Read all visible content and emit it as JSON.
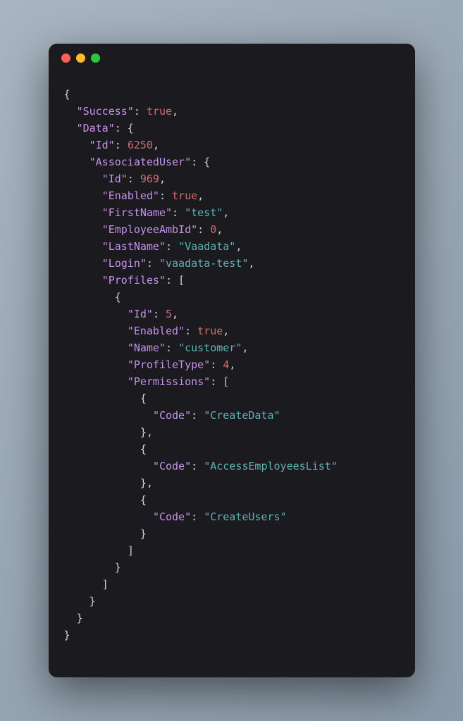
{
  "window": {
    "traffic_lights": {
      "red": "#ff5f56",
      "yellow": "#ffbd2e",
      "green": "#27c93f"
    }
  },
  "code": {
    "lines": [
      {
        "indent": 0,
        "tokens": [
          {
            "t": "punct",
            "v": "{"
          }
        ]
      },
      {
        "indent": 1,
        "tokens": [
          {
            "t": "key",
            "v": "\"Success\""
          },
          {
            "t": "punct",
            "v": ": "
          },
          {
            "t": "bool",
            "v": "true"
          },
          {
            "t": "punct",
            "v": ","
          }
        ]
      },
      {
        "indent": 1,
        "tokens": [
          {
            "t": "key",
            "v": "\"Data\""
          },
          {
            "t": "punct",
            "v": ": {"
          }
        ]
      },
      {
        "indent": 2,
        "tokens": [
          {
            "t": "key",
            "v": "\"Id\""
          },
          {
            "t": "punct",
            "v": ": "
          },
          {
            "t": "number",
            "v": "6250"
          },
          {
            "t": "punct",
            "v": ","
          }
        ]
      },
      {
        "indent": 2,
        "tokens": [
          {
            "t": "key",
            "v": "\"AssociatedUser\""
          },
          {
            "t": "punct",
            "v": ": {"
          }
        ]
      },
      {
        "indent": 3,
        "tokens": [
          {
            "t": "key",
            "v": "\"Id\""
          },
          {
            "t": "punct",
            "v": ": "
          },
          {
            "t": "number",
            "v": "969"
          },
          {
            "t": "punct",
            "v": ","
          }
        ]
      },
      {
        "indent": 3,
        "tokens": [
          {
            "t": "key",
            "v": "\"Enabled\""
          },
          {
            "t": "punct",
            "v": ": "
          },
          {
            "t": "bool",
            "v": "true"
          },
          {
            "t": "punct",
            "v": ","
          }
        ]
      },
      {
        "indent": 3,
        "tokens": [
          {
            "t": "key",
            "v": "\"FirstName\""
          },
          {
            "t": "punct",
            "v": ": "
          },
          {
            "t": "string",
            "v": "\"test\""
          },
          {
            "t": "punct",
            "v": ","
          }
        ]
      },
      {
        "indent": 3,
        "tokens": [
          {
            "t": "key",
            "v": "\"EmployeeAmbId\""
          },
          {
            "t": "punct",
            "v": ": "
          },
          {
            "t": "number",
            "v": "0"
          },
          {
            "t": "punct",
            "v": ","
          }
        ]
      },
      {
        "indent": 3,
        "tokens": [
          {
            "t": "key",
            "v": "\"LastName\""
          },
          {
            "t": "punct",
            "v": ": "
          },
          {
            "t": "string",
            "v": "\"Vaadata\""
          },
          {
            "t": "punct",
            "v": ","
          }
        ]
      },
      {
        "indent": 3,
        "tokens": [
          {
            "t": "key",
            "v": "\"Login\""
          },
          {
            "t": "punct",
            "v": ": "
          },
          {
            "t": "string",
            "v": "\"vaadata-test\""
          },
          {
            "t": "punct",
            "v": ","
          }
        ]
      },
      {
        "indent": 3,
        "tokens": [
          {
            "t": "key",
            "v": "\"Profiles\""
          },
          {
            "t": "punct",
            "v": ": ["
          }
        ]
      },
      {
        "indent": 4,
        "tokens": [
          {
            "t": "punct",
            "v": "{"
          }
        ]
      },
      {
        "indent": 5,
        "tokens": [
          {
            "t": "key",
            "v": "\"Id\""
          },
          {
            "t": "punct",
            "v": ": "
          },
          {
            "t": "number",
            "v": "5"
          },
          {
            "t": "punct",
            "v": ","
          }
        ]
      },
      {
        "indent": 5,
        "tokens": [
          {
            "t": "key",
            "v": "\"Enabled\""
          },
          {
            "t": "punct",
            "v": ": "
          },
          {
            "t": "bool",
            "v": "true"
          },
          {
            "t": "punct",
            "v": ","
          }
        ]
      },
      {
        "indent": 5,
        "tokens": [
          {
            "t": "key",
            "v": "\"Name\""
          },
          {
            "t": "punct",
            "v": ": "
          },
          {
            "t": "string",
            "v": "\"customer\""
          },
          {
            "t": "punct",
            "v": ","
          }
        ]
      },
      {
        "indent": 5,
        "tokens": [
          {
            "t": "key",
            "v": "\"ProfileType\""
          },
          {
            "t": "punct",
            "v": ": "
          },
          {
            "t": "number",
            "v": "4"
          },
          {
            "t": "punct",
            "v": ","
          }
        ]
      },
      {
        "indent": 5,
        "tokens": [
          {
            "t": "key",
            "v": "\"Permissions\""
          },
          {
            "t": "punct",
            "v": ": ["
          }
        ]
      },
      {
        "indent": 6,
        "tokens": [
          {
            "t": "punct",
            "v": "{"
          }
        ]
      },
      {
        "indent": 7,
        "tokens": [
          {
            "t": "key",
            "v": "\"Code\""
          },
          {
            "t": "punct",
            "v": ": "
          },
          {
            "t": "string",
            "v": "\"CreateData\""
          }
        ]
      },
      {
        "indent": 6,
        "tokens": [
          {
            "t": "punct",
            "v": "},"
          }
        ]
      },
      {
        "indent": 6,
        "tokens": [
          {
            "t": "punct",
            "v": "{"
          }
        ]
      },
      {
        "indent": 7,
        "tokens": [
          {
            "t": "key",
            "v": "\"Code\""
          },
          {
            "t": "punct",
            "v": ": "
          },
          {
            "t": "string",
            "v": "\"AccessEmployeesList\""
          }
        ]
      },
      {
        "indent": 6,
        "tokens": [
          {
            "t": "punct",
            "v": "},"
          }
        ]
      },
      {
        "indent": 6,
        "tokens": [
          {
            "t": "punct",
            "v": "{"
          }
        ]
      },
      {
        "indent": 7,
        "tokens": [
          {
            "t": "key",
            "v": "\"Code\""
          },
          {
            "t": "punct",
            "v": ": "
          },
          {
            "t": "string",
            "v": "\"CreateUsers\""
          }
        ]
      },
      {
        "indent": 6,
        "tokens": [
          {
            "t": "punct",
            "v": "}"
          }
        ]
      },
      {
        "indent": 5,
        "tokens": [
          {
            "t": "punct",
            "v": "]"
          }
        ]
      },
      {
        "indent": 4,
        "tokens": [
          {
            "t": "punct",
            "v": "}"
          }
        ]
      },
      {
        "indent": 3,
        "tokens": [
          {
            "t": "punct",
            "v": "]"
          }
        ]
      },
      {
        "indent": 2,
        "tokens": [
          {
            "t": "punct",
            "v": "}"
          }
        ]
      },
      {
        "indent": 1,
        "tokens": [
          {
            "t": "punct",
            "v": "}"
          }
        ]
      },
      {
        "indent": 0,
        "tokens": [
          {
            "t": "punct",
            "v": "}"
          }
        ]
      }
    ]
  }
}
